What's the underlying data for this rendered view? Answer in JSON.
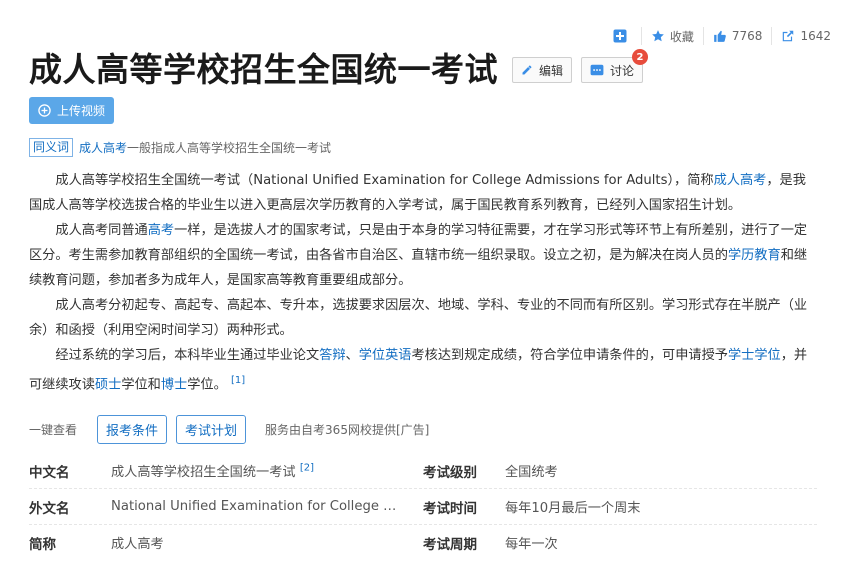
{
  "toolbar": {
    "collect_label": "收藏",
    "like_count": "7768",
    "share_count": "1642"
  },
  "title": "成人高等学校招生全国统一考试",
  "actions": {
    "edit_label": "编辑",
    "discuss_label": "讨论",
    "discuss_badge": "2"
  },
  "upload_label": "上传视频",
  "synonym": {
    "tag": "同义词",
    "term": "成人高考",
    "text": "一般指成人高等学校招生全国统一考试"
  },
  "summary": {
    "p1": {
      "a": "成人高等学校招生全国统一考试（National Unified Examination for College Admissions for Adults），简称",
      "link1": "成人高考",
      "b": "，是我国成人高等学校选拔合格的毕业生以进入更高层次学历教育的入学考试，属于国民教育系列教育，已经列入国家招生计划。"
    },
    "p2": {
      "a": "成人高考同普通",
      "link1": "高考",
      "b": "一样，是选拔人才的国家考试，只是由于本身的学习特征需要，才在学习形式等环节上有所差别，进行了一定区分。考生需参加教育部组织的全国统一考试，由各省市自治区、直辖市统一组织录取。设立之初，是为解决在岗人员的",
      "link2": "学历教育",
      "c": "和继续教育问题，参加者多为成年人，是国家高等教育重要组成部分。"
    },
    "p3": "成人高考分初起专、高起专、高起本、专升本，选拔要求因层次、地域、学科、专业的不同而有所区别。学习形式存在半脱产（业余）和函授（利用空闲时间学习）两种形式。",
    "p4": {
      "a": "经过系统的学习后，本科毕业生通过毕业论文",
      "link1": "答辩",
      "b": "、",
      "link2": "学位英语",
      "c": "考核达到规定成绩，符合学位申请条件的，可申请授予",
      "link3": "学士学位",
      "d": "，并可继续攻读",
      "link4": "硕士",
      "e": "学位和",
      "link5": "博士",
      "f": "学位。",
      "ref": "[1]"
    }
  },
  "quick": {
    "label": "一键查看",
    "btn1": "报考条件",
    "btn2": "考试计划",
    "service": "服务由自考365网校提供[广告]"
  },
  "info": {
    "rows": [
      {
        "k1": "中文名",
        "v1": "成人高等学校招生全国统一考试",
        "ref1": "[2]",
        "k2": "考试级别",
        "v2": "全国统考"
      },
      {
        "k1": "外文名",
        "v1": "National Unified Examination for College Admissions for Adults",
        "ref1": "",
        "k2": "考试时间",
        "v2": "每年10月最后一个周末"
      },
      {
        "k1": "简称",
        "v1": "成人高考",
        "ref1": "",
        "k2": "考试周期",
        "v2": "每年一次"
      }
    ]
  },
  "colors": {
    "accent": "#136ec2",
    "upload_bg": "#5ba7e8",
    "badge": "#e74c3c"
  }
}
